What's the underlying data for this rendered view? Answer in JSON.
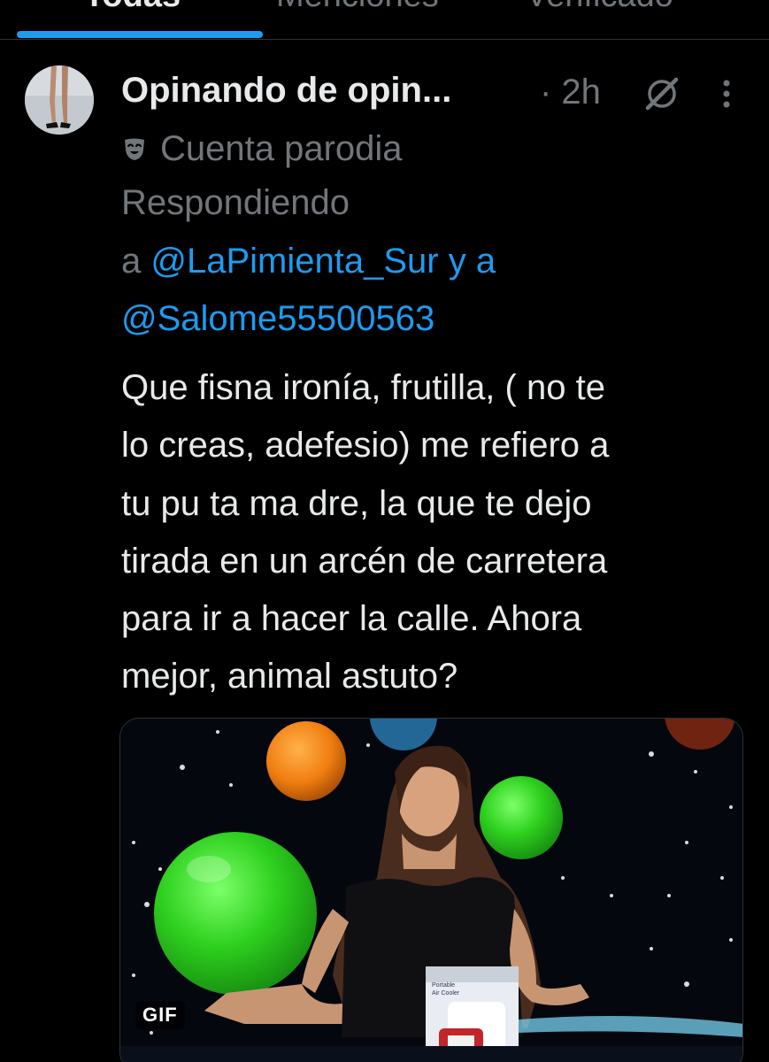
{
  "tabs": [
    {
      "label": "Todas"
    },
    {
      "label": "Menciones"
    },
    {
      "label": "Verificado"
    }
  ],
  "tweet": {
    "author_name": "Opinando de opin...",
    "time": "· 2h",
    "parody_label": "Cuenta parodia",
    "reply_prefix_line1": "Respondiendo",
    "reply_a": "a",
    "mention_1": "@LaPimienta_Sur",
    "reply_conj": "y a",
    "mention_2": "@Salome55500563",
    "text_lines": [
      "Que fisna ironía, frutilla, ( no te",
      "lo creas, adefesio) me refiero a",
      "tu pu ta ma dre, la que te dejo",
      "tirada en un arcén de carretera",
      "para ir a hacer la calle. Ahora",
      "mejor, animal astuto?"
    ],
    "media": {
      "type": "gif",
      "badge": "GIF",
      "box_label_1": "Portable",
      "box_label_2": "Air Cooler"
    }
  },
  "icons": {
    "grok": "grok-icon",
    "more": "more-icon",
    "mask": "mask-icon"
  },
  "colors": {
    "background": "#000000",
    "text": "#e7e9ea",
    "secondary": "#71767b",
    "link": "#1d9bf0",
    "accent": "#1d9bf0"
  }
}
